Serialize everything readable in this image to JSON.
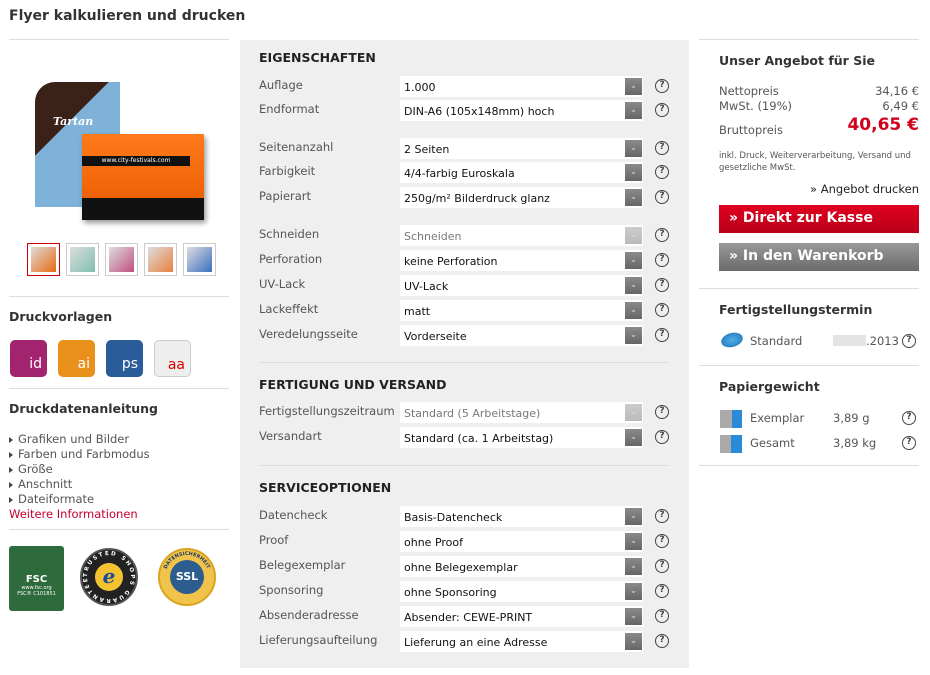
{
  "title": "Flyer kalkulieren und drucken",
  "left": {
    "templates_heading": "Druckvorlagen",
    "templates": [
      {
        "label": "id",
        "color": "#a3246e"
      },
      {
        "label": "ai",
        "color": "#e8901a"
      },
      {
        "label": "ps",
        "color": "#2a5c9a"
      },
      {
        "label": "aa",
        "color": "#eeeeee"
      }
    ],
    "guide_heading": "Druckdatenanleitung",
    "guide_links": [
      "Grafiken und Bilder",
      "Farben und Farbmodus",
      "Größe",
      "Anschnitt",
      "Dateiformate"
    ],
    "more_link": "Weitere Informationen",
    "hero_text": {
      "tartan": "Tartan",
      "url": "www.city-festivals.com"
    },
    "badges": {
      "fsc": "FSC",
      "fsc_url": "www.fsc.org",
      "fsc_code": "FSC® C101851",
      "trusted": "TRUSTED SHOPS GUARANTEE",
      "ssl": "SSL",
      "ssl_ring": "DATENSICHERHEIT"
    }
  },
  "config": {
    "sections": [
      {
        "title": "EIGENSCHAFTEN",
        "groups": [
          [
            {
              "label": "Auflage",
              "value": "1.000"
            },
            {
              "label": "Endformat",
              "value": "DIN-A6 (105x148mm) hoch"
            }
          ],
          [
            {
              "label": "Seitenanzahl",
              "value": "2 Seiten"
            },
            {
              "label": "Farbigkeit",
              "value": "4/4-farbig Euroskala"
            },
            {
              "label": "Papierart",
              "value": "250g/m² Bilderdruck glanz"
            }
          ],
          [
            {
              "label": "Schneiden",
              "value": "Schneiden",
              "disabled": true
            },
            {
              "label": "Perforation",
              "value": "keine Perforation"
            },
            {
              "label": "UV-Lack",
              "value": "UV-Lack"
            },
            {
              "label": "Lackeffekt",
              "value": "matt"
            },
            {
              "label": "Veredelungsseite",
              "value": "Vorderseite"
            }
          ]
        ]
      },
      {
        "title": "FERTIGUNG UND VERSAND",
        "groups": [
          [
            {
              "label": "Fertigstellungszeitraum",
              "value": "Standard (5 Arbeitstage)",
              "disabled": true
            },
            {
              "label": "Versandart",
              "value": "Standard (ca. 1 Arbeitstag)"
            }
          ]
        ]
      },
      {
        "title": "SERVICEOPTIONEN",
        "groups": [
          [
            {
              "label": "Datencheck",
              "value": "Basis-Datencheck"
            },
            {
              "label": "Proof",
              "value": "ohne Proof"
            },
            {
              "label": "Belegexemplar",
              "value": "ohne Belegexemplar"
            },
            {
              "label": "Sponsoring",
              "value": "ohne Sponsoring"
            },
            {
              "label": "Absenderadresse",
              "value": "Absender: CEWE-PRINT"
            },
            {
              "label": "Lieferungsaufteilung",
              "value": "Lieferung an eine Adresse"
            }
          ]
        ]
      }
    ],
    "help_glyph": "?",
    "dropdown_glyph": "⌄"
  },
  "offer": {
    "heading": "Unser Angebot für Sie",
    "net_label": "Nettopreis",
    "net": "34,16 €",
    "vat_label": "MwSt. (19%)",
    "vat": "6,49 €",
    "gross_label": "Bruttopreis",
    "gross": "40,65 €",
    "note": "inkl. Druck, Weiterverarbeitung, Versand und gesetzliche MwSt.",
    "print_offer": "» Angebot drucken",
    "checkout": "»  Direkt zur Kasse",
    "cart": "»  In den Warenkorb",
    "accent": "#d0021b"
  },
  "completion": {
    "heading": "Fertigstellungstermin",
    "label": "Standard",
    "date": ".2013"
  },
  "weight": {
    "heading": "Papiergewicht",
    "rows": [
      {
        "label": "Exemplar",
        "value": "3,89 g"
      },
      {
        "label": "Gesamt",
        "value": "3,89 kg"
      }
    ]
  }
}
